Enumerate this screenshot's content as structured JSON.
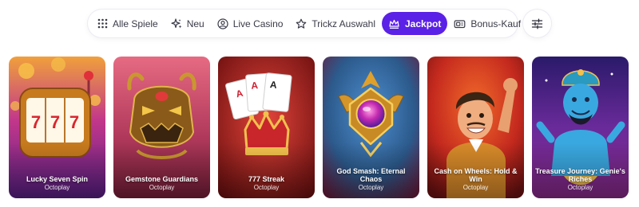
{
  "tabs": [
    {
      "label": "Alle Spiele",
      "icon": "grid-icon",
      "active": false
    },
    {
      "label": "Neu",
      "icon": "sparkle-icon",
      "active": false
    },
    {
      "label": "Live Casino",
      "icon": "live-dealer-icon",
      "active": false
    },
    {
      "label": "Trickz Auswahl",
      "icon": "star-icon",
      "active": false
    },
    {
      "label": "Jackpot",
      "icon": "crown-icon",
      "active": true
    },
    {
      "label": "Bonus-Kauf",
      "icon": "ticket-icon",
      "active": false
    }
  ],
  "filter_button": {
    "icon": "sliders-icon"
  },
  "games": [
    {
      "title": "Lucky Seven Spin",
      "provider": "Octoplay"
    },
    {
      "title": "Gemstone Guardians",
      "provider": "Octoplay"
    },
    {
      "title": "777 Streak",
      "provider": "Octoplay"
    },
    {
      "title": "God Smash: Eternal Chaos",
      "provider": "Octoplay"
    },
    {
      "title": "Cash on Wheels: Hold & Win",
      "provider": "Octoplay"
    },
    {
      "title": "Treasure Journey: Genie's Riches",
      "provider": "Octoplay"
    }
  ],
  "colors": {
    "accent": "#5b21e6",
    "tab_text": "#3a3a48"
  }
}
